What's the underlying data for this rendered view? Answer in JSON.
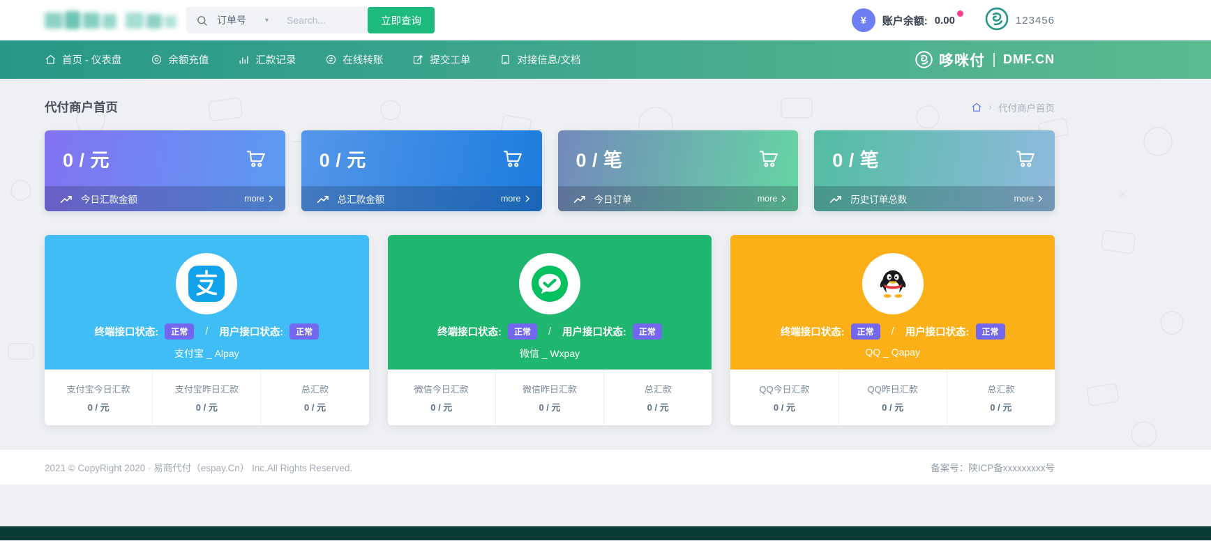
{
  "header": {
    "search": {
      "category": "订单号",
      "placeholder": "Search...",
      "submit": "立即查询"
    },
    "balance": {
      "symbol": "¥",
      "label": "账户余额:",
      "value": "0.00"
    },
    "user_id": "123456"
  },
  "nav": {
    "items": [
      {
        "label": "首页 - 仪表盘"
      },
      {
        "label": "余额充值"
      },
      {
        "label": "汇款记录"
      },
      {
        "label": "在线转账"
      },
      {
        "label": "提交工单"
      },
      {
        "label": "对接信息/文档"
      }
    ],
    "brand": {
      "name": "哆咪付",
      "domain": "DMF.CN"
    }
  },
  "page": {
    "title": "代付商户首页",
    "breadcrumb_current": "代付商户首页"
  },
  "stat_cards": [
    {
      "value": "0 / 元",
      "label": "今日汇款金额",
      "more_label": "more",
      "gradient": [
        "#8373f1",
        "#5a9bf2"
      ]
    },
    {
      "value": "0 / 元",
      "label": "总汇款金额",
      "more_label": "more",
      "gradient": [
        "#5597ea",
        "#1c7cdd"
      ]
    },
    {
      "value": "0 / 笔",
      "label": "今日订单",
      "more_label": "more",
      "gradient": [
        "#7389bb",
        "#65d6a3"
      ]
    },
    {
      "value": "0 / 笔",
      "label": "历史订单总数",
      "more_label": "more",
      "gradient": [
        "#52bda1",
        "#8fb9de"
      ]
    }
  ],
  "pay_cards": [
    {
      "brand": "alipay",
      "panel_color": "#41bdf5",
      "name": "支付宝 _ Alpay",
      "status": {
        "label1": "终端接口状态:",
        "value1": "正常",
        "separator": "/",
        "label2": "用户接口状态:",
        "value2": "正常"
      },
      "stats": [
        {
          "label": "支付宝今日汇款",
          "value": "0 / 元"
        },
        {
          "label": "支付宝昨日汇款",
          "value": "0 / 元"
        },
        {
          "label": "总汇款",
          "value": "0 / 元"
        }
      ]
    },
    {
      "brand": "wechat",
      "panel_color": "#1fb66f",
      "name": "微信 _ Wxpay",
      "status": {
        "label1": "终端接口状态:",
        "value1": "正常",
        "separator": "/",
        "label2": "用户接口状态:",
        "value2": "正常"
      },
      "stats": [
        {
          "label": "微信今日汇款",
          "value": "0 / 元"
        },
        {
          "label": "微信昨日汇款",
          "value": "0 / 元"
        },
        {
          "label": "总汇款",
          "value": "0 / 元"
        }
      ]
    },
    {
      "brand": "qq",
      "panel_color": "#fcb018",
      "name": "QQ _ Qapay",
      "status": {
        "label1": "终端接口状态:",
        "value1": "正常",
        "separator": "/",
        "label2": "用户接口状态:",
        "value2": "正常"
      },
      "stats": [
        {
          "label": "QQ今日汇款",
          "value": "0 / 元"
        },
        {
          "label": "QQ昨日汇款",
          "value": "0 / 元"
        },
        {
          "label": "总汇款",
          "value": "0 / 元"
        }
      ]
    }
  ],
  "footer": {
    "copyright": "2021 © CopyRight 2020 · 易商代付（espay.Cn） Inc.All Rights Reserved.",
    "icp": "备案号：陕ICP备xxxxxxxxx号"
  },
  "colors": {
    "primary_green": "#1eba7d",
    "nav_gradient": [
      "#279788",
      "#5cba90"
    ],
    "status_badge": "#7367f0",
    "balance_icon": "#6e7ff3",
    "notification_dot": "#fd3e8d",
    "bottom_strip": "#0a3b35"
  }
}
